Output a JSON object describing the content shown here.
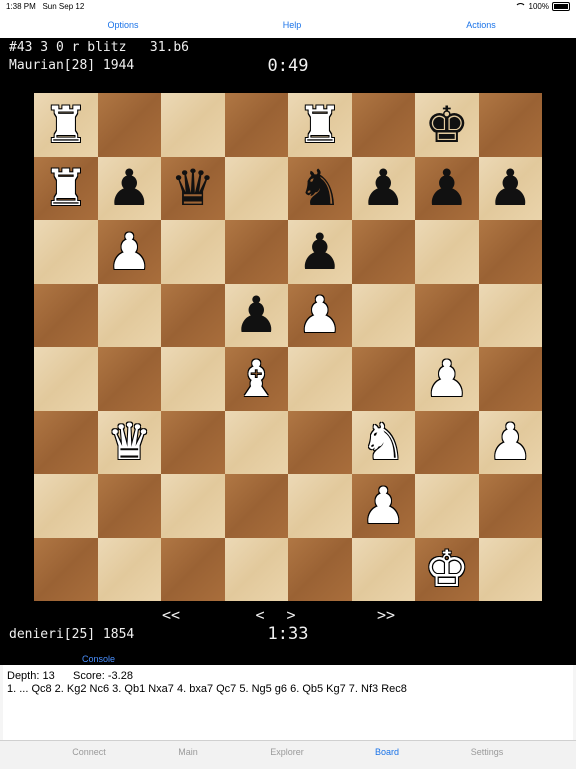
{
  "status": {
    "time": "1:38 PM",
    "date": "Sun Sep 12",
    "battery": "100%"
  },
  "topbar": {
    "options": "Options",
    "help": "Help",
    "actions": "Actions"
  },
  "game": {
    "info": "#43 3 0 r blitz   31.b6",
    "top_player": "Maurian[28] 1944",
    "top_clock": "0:49",
    "bottom_player": "denieri[25] 1854",
    "bottom_clock": "1:33"
  },
  "board": {
    "ranks": [
      [
        "wr",
        "",
        "",
        "",
        "wr",
        "",
        "bk",
        ""
      ],
      [
        "wr",
        "bp",
        "bq",
        "",
        "bn",
        "bp",
        "bp",
        "bp"
      ],
      [
        "",
        "wp",
        "",
        "",
        "bp",
        "",
        "",
        ""
      ],
      [
        "",
        "",
        "",
        "bp",
        "wp",
        "",
        "",
        ""
      ],
      [
        "",
        "",
        "",
        "wb",
        "",
        "",
        "wp",
        ""
      ],
      [
        "",
        "wq",
        "",
        "",
        "",
        "wn",
        "",
        "wp"
      ],
      [
        "",
        "",
        "",
        "",
        "",
        "wp",
        "",
        ""
      ],
      [
        "",
        "",
        "",
        "",
        "",
        "",
        "wk",
        ""
      ]
    ]
  },
  "nav": {
    "first": "<<",
    "prev": "<",
    "next": ">",
    "last": ">>"
  },
  "console": {
    "link": "Console",
    "depth_line": "Depth: 13      Score: -3.28",
    "pv_line": "1. ... Qc8 2. Kg2 Nc6 3. Qb1 Nxa7 4. bxa7 Qc7 5. Ng5 g6 6. Qb5 Kg7 7. Nf3 Rec8"
  },
  "tabs": [
    {
      "label": "Connect",
      "active": false
    },
    {
      "label": "Main",
      "active": false
    },
    {
      "label": "Explorer",
      "active": false
    },
    {
      "label": "Board",
      "active": true
    },
    {
      "label": "Settings",
      "active": false
    }
  ]
}
